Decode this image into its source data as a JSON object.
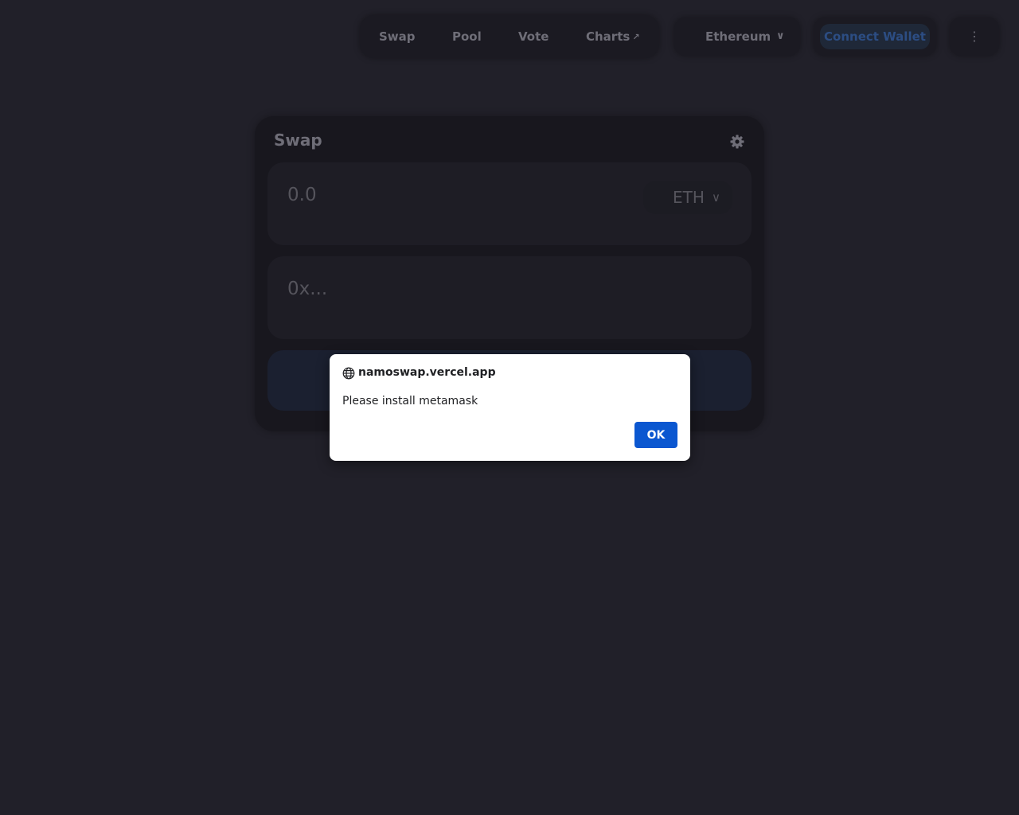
{
  "nav": {
    "items": [
      {
        "label": "Swap"
      },
      {
        "label": "Pool"
      },
      {
        "label": "Vote"
      },
      {
        "label": "Charts",
        "external_icon": "arrow-up-right-icon",
        "glyph": "↗"
      }
    ]
  },
  "network": {
    "label": "Ethereum",
    "icon": "chevron-down-icon",
    "glyph": "∨"
  },
  "wallet": {
    "label": "Connect Wallet",
    "color": "#2c4d83"
  },
  "more": {
    "icon": "more-vertical-icon",
    "glyph": "⋮"
  },
  "swap_card": {
    "title": "Swap",
    "settings_icon": "gear-icon",
    "amount_input": {
      "value": "",
      "placeholder": "0.0"
    },
    "token": {
      "symbol": "ETH",
      "icon": "chevron-down-icon",
      "glyph": "∨"
    },
    "address_input": {
      "value": "",
      "placeholder": "0x..."
    },
    "submit_label": ""
  },
  "dialog": {
    "origin": "namoswap.vercel.app",
    "origin_icon": "globe-icon",
    "message": "Please install metamask",
    "ok_label": "OK",
    "accent": "#0b57d0"
  },
  "colors": {
    "background": "#212029",
    "card": "#18171e",
    "muted_text": "#6f6e78"
  }
}
